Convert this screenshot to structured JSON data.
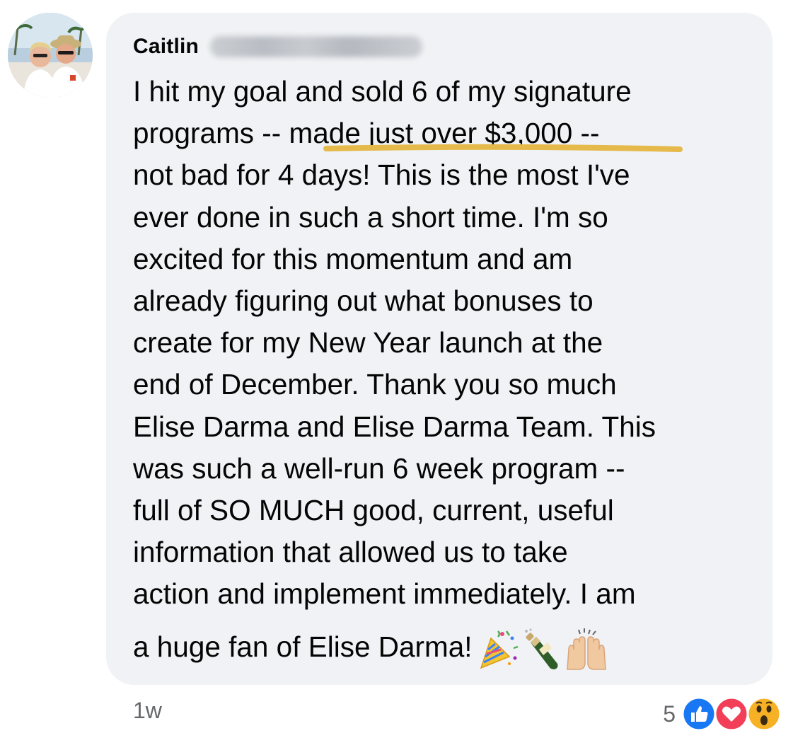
{
  "comment": {
    "author_first_name": "Caitlin",
    "author_last_name_blurred": true,
    "lines": [
      "I hit my goal and sold 6 of my signature",
      "programs -- made just over $3,000 --",
      "not bad for 4 days! This is the most I've",
      "ever done in such a short time. I'm so",
      "excited for this momentum and am",
      "already figuring out what bonuses to",
      "create for my New Year launch at the",
      "end of December. Thank you so much",
      "Elise Darma and Elise Darma Team. This",
      "was such a well-run 6 week program --",
      "full of SO MUCH good, current, useful",
      "information that allowed us to take",
      "action and implement immediately. I am",
      "a huge fan of Elise Darma!"
    ],
    "highlighted_phrase": "made just over $3,000",
    "emojis": [
      "party-popper-icon",
      "champagne-icon",
      "raised-hands-icon"
    ],
    "highlight_color": "#e5b94a",
    "bubble_color": "#f0f2f5"
  },
  "meta": {
    "timestamp": "1w",
    "reaction_count": "5",
    "reactions": [
      "like-reaction-icon",
      "love-reaction-icon",
      "wow-reaction-icon"
    ],
    "like_color": "#1877f2",
    "love_color": "#f33e58",
    "wow_color": "#f7b125"
  }
}
